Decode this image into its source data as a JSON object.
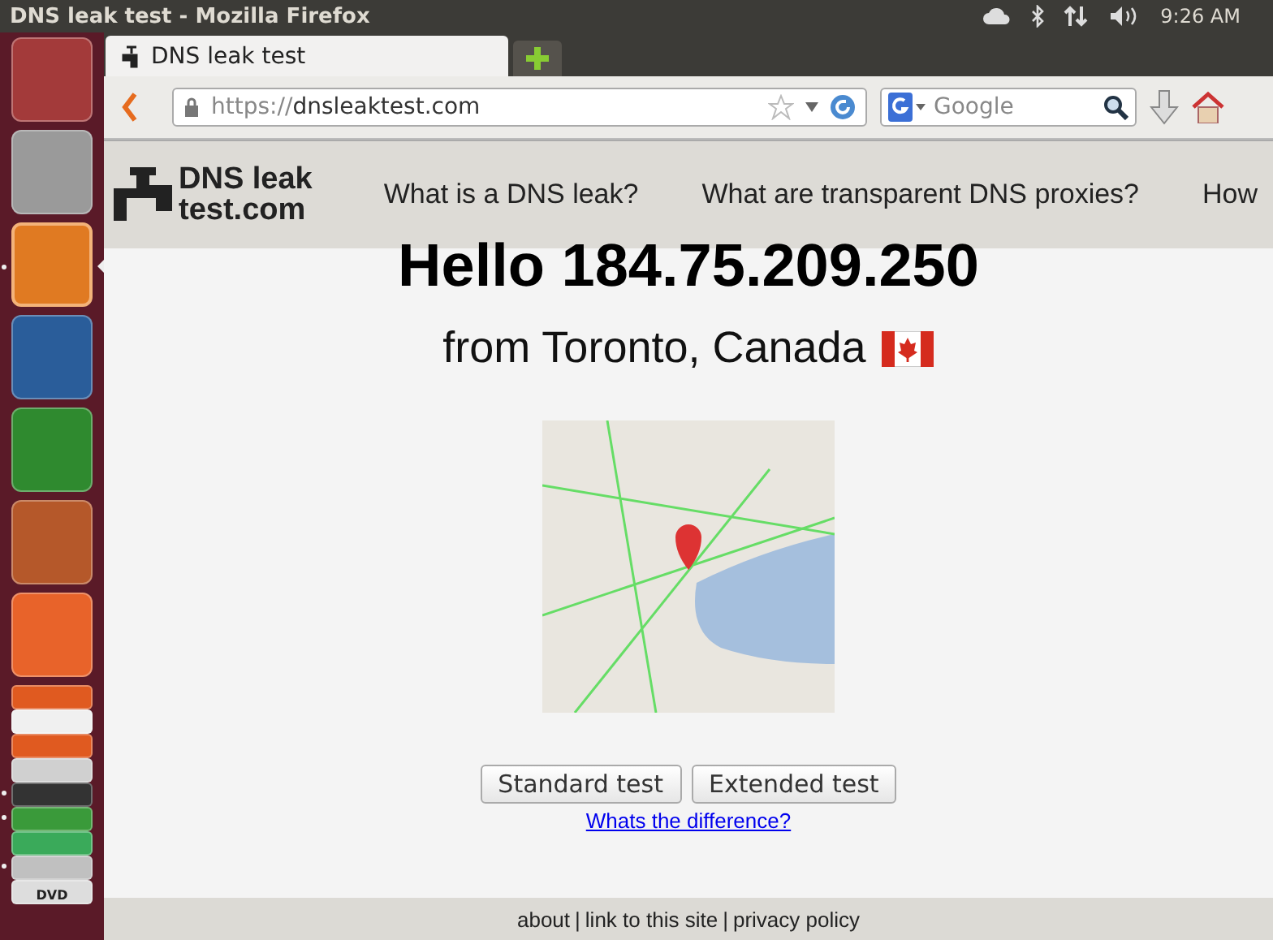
{
  "top_bar": {
    "title": "DNS leak test - Mozilla Firefox",
    "time": "9:26 AM"
  },
  "launcher": [
    {
      "kind": "dash",
      "running": false,
      "focused": false,
      "folded": false
    },
    {
      "kind": "files",
      "running": false,
      "focused": false,
      "folded": false
    },
    {
      "kind": "browser",
      "running": true,
      "focused": true,
      "folded": false
    },
    {
      "kind": "writer",
      "running": false,
      "focused": false,
      "folded": false
    },
    {
      "kind": "calc",
      "running": false,
      "focused": false,
      "folded": false
    },
    {
      "kind": "impress",
      "running": false,
      "focused": false,
      "folded": false
    },
    {
      "kind": "store",
      "running": false,
      "focused": false,
      "folded": false
    },
    {
      "kind": "cloud",
      "running": false,
      "focused": false,
      "folded": true
    },
    {
      "kind": "amazon",
      "running": false,
      "focused": false,
      "folded": true
    },
    {
      "kind": "music",
      "running": false,
      "focused": false,
      "folded": true
    },
    {
      "kind": "settings",
      "running": false,
      "focused": false,
      "folded": true
    },
    {
      "kind": "terminal",
      "running": true,
      "focused": false,
      "folded": true
    },
    {
      "kind": "sync",
      "running": true,
      "focused": false,
      "folded": true
    },
    {
      "kind": "network",
      "running": false,
      "focused": false,
      "folded": true
    },
    {
      "kind": "drawing",
      "running": true,
      "focused": false,
      "folded": true
    },
    {
      "kind": "disc",
      "running": false,
      "focused": false,
      "folded": true,
      "label": "DVD"
    }
  ],
  "tabs": [
    {
      "label": "DNS leak test",
      "selected": true
    }
  ],
  "address_bar": {
    "scheme": "https://",
    "host": "dnsleaktest.com"
  },
  "search": {
    "placeholder": "Google"
  },
  "site": {
    "logo": [
      "DNS leak",
      "test.com"
    ],
    "nav": [
      "What is a DNS leak?",
      "What are transparent DNS proxies?",
      "How"
    ]
  },
  "greeting": "Hello 184.75.209.250",
  "location": "from Toronto, Canada",
  "buttons": [
    "Standard test",
    "Extended test"
  ],
  "difference_link": "Whats the difference?",
  "footer": {
    "links": [
      "about",
      "link to this site",
      "privacy policy"
    ],
    "separator": "|"
  }
}
